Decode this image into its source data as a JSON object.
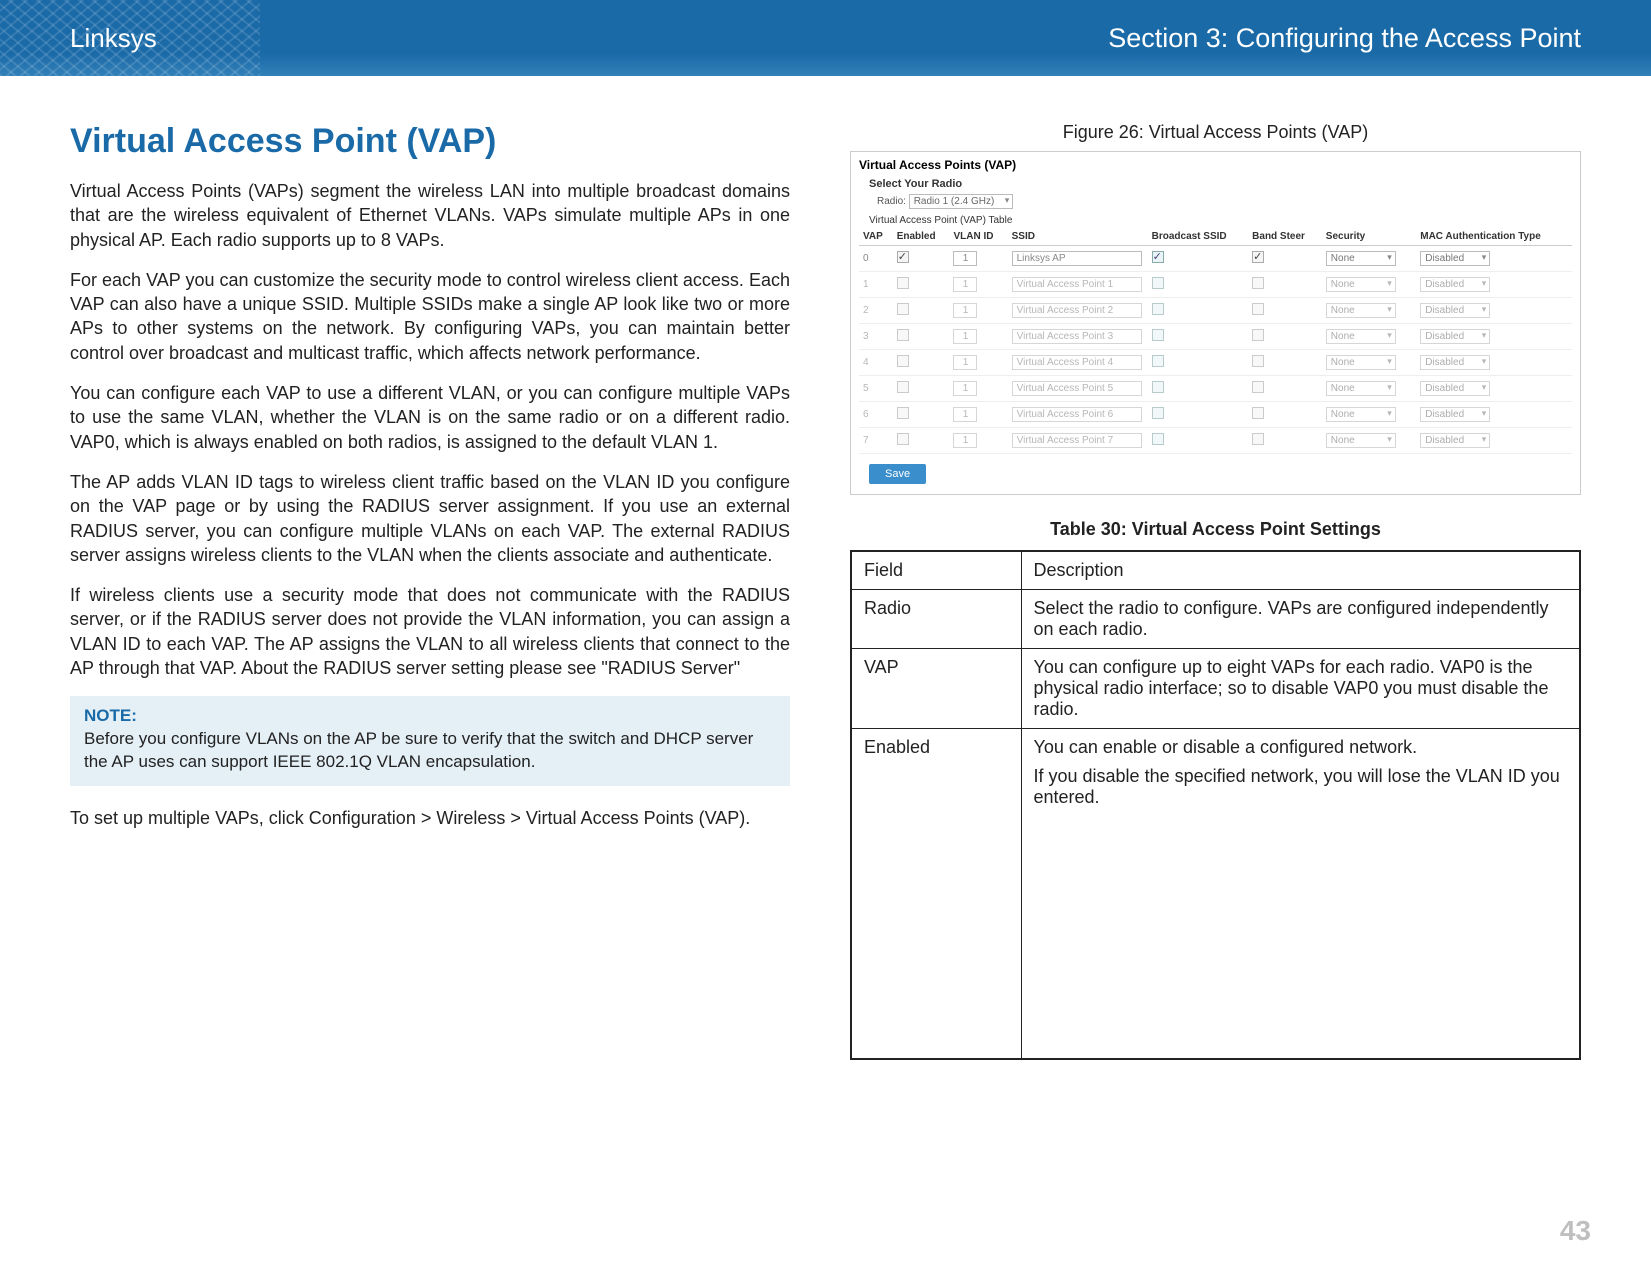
{
  "header": {
    "brand": "Linksys",
    "section": "Section 3:  Configuring the Access Point"
  },
  "left": {
    "title": "Virtual Access Point (VAP)",
    "p1": "Virtual Access Points (VAPs) segment the wireless LAN into multiple broadcast domains that are the wireless equivalent of Ethernet VLANs. VAPs simulate multiple APs in one physical AP. Each radio supports up to 8 VAPs.",
    "p2": "For each VAP you can customize the security mode to control wireless client access. Each VAP can also have a unique SSID. Multiple SSIDs make a single AP look like two or more APs to other systems on the network. By configuring VAPs, you can maintain better control over broadcast and multicast traffic, which affects network performance.",
    "p3": "You can configure each VAP to use a different VLAN, or you can configure multiple VAPs to use the same VLAN, whether the VLAN is on the same radio or on a different radio. VAP0, which is always enabled on both radios, is assigned to the default VLAN 1.",
    "p4": "The AP adds VLAN ID tags to wireless client traffic based on the VLAN ID you configure on the VAP page or by using the RADIUS server assignment. If you use an external RADIUS server, you can configure multiple VLANs on each VAP. The external RADIUS server assigns wireless clients to the VLAN when the clients associate and authenticate.",
    "p5": "If wireless clients use a security mode that does not communicate with the RADIUS server, or if the RADIUS server does not provide the VLAN information, you can assign a VLAN ID to each VAP. The AP assigns the VLAN to all wireless clients that connect to the AP through that VAP. About the RADIUS server setting please see \"RADIUS Server\"",
    "note_title": "NOTE:",
    "note_body": "Before you configure VLANs on the AP be sure to verify that the switch and DHCP server the AP uses can support IEEE 802.1Q VLAN encapsulation.",
    "p6": "To set up multiple VAPs, click Configuration > Wireless > Virtual Access Points (VAP)."
  },
  "figure": {
    "caption": "Figure 26: Virtual Access Points (VAP)",
    "ss_title": "Virtual Access Points (VAP)",
    "select_label": "Select Your Radio",
    "radio_label": "Radio:",
    "radio_value": "Radio 1 (2.4 GHz)",
    "table_caption": "Virtual Access Point (VAP) Table",
    "headers": {
      "vap": "VAP",
      "enabled": "Enabled",
      "vlan": "VLAN ID",
      "ssid": "SSID",
      "bcast": "Broadcast SSID",
      "band": "Band Steer",
      "security": "Security",
      "mac": "MAC Authentication Type"
    },
    "rows": [
      {
        "vap": "0",
        "vlan": "1",
        "ssid": "Linksys AP",
        "sec": "None",
        "mac": "Disabled",
        "enabled": true,
        "bcast": true,
        "band": true,
        "faded": false
      },
      {
        "vap": "1",
        "vlan": "1",
        "ssid": "Virtual Access Point 1",
        "sec": "None",
        "mac": "Disabled",
        "enabled": false,
        "bcast": false,
        "band": false,
        "faded": true
      },
      {
        "vap": "2",
        "vlan": "1",
        "ssid": "Virtual Access Point 2",
        "sec": "None",
        "mac": "Disabled",
        "enabled": false,
        "bcast": false,
        "band": false,
        "faded": true
      },
      {
        "vap": "3",
        "vlan": "1",
        "ssid": "Virtual Access Point 3",
        "sec": "None",
        "mac": "Disabled",
        "enabled": false,
        "bcast": false,
        "band": false,
        "faded": true
      },
      {
        "vap": "4",
        "vlan": "1",
        "ssid": "Virtual Access Point 4",
        "sec": "None",
        "mac": "Disabled",
        "enabled": false,
        "bcast": false,
        "band": false,
        "faded": true
      },
      {
        "vap": "5",
        "vlan": "1",
        "ssid": "Virtual Access Point 5",
        "sec": "None",
        "mac": "Disabled",
        "enabled": false,
        "bcast": false,
        "band": false,
        "faded": true
      },
      {
        "vap": "6",
        "vlan": "1",
        "ssid": "Virtual Access Point 6",
        "sec": "None",
        "mac": "Disabled",
        "enabled": false,
        "bcast": false,
        "band": false,
        "faded": true
      },
      {
        "vap": "7",
        "vlan": "1",
        "ssid": "Virtual Access Point 7",
        "sec": "None",
        "mac": "Disabled",
        "enabled": false,
        "bcast": false,
        "band": false,
        "faded": true
      }
    ],
    "save": "Save"
  },
  "table": {
    "caption": "Table 30: Virtual Access Point Settings",
    "h_field": "Field",
    "h_desc": "Description",
    "rows": [
      {
        "field": "Radio",
        "desc": "Select the radio to configure. VAPs are configured independently on each radio."
      },
      {
        "field": "VAP",
        "desc": "You can configure up to eight VAPs for each radio. VAP0 is the physical radio interface; so to disable VAP0 you must disable the radio."
      },
      {
        "field": "Enabled",
        "desc": "You can enable or disable a configured network.",
        "desc2": "If you disable the specified network, you will lose the VLAN ID you entered."
      }
    ]
  },
  "page_number": "43"
}
